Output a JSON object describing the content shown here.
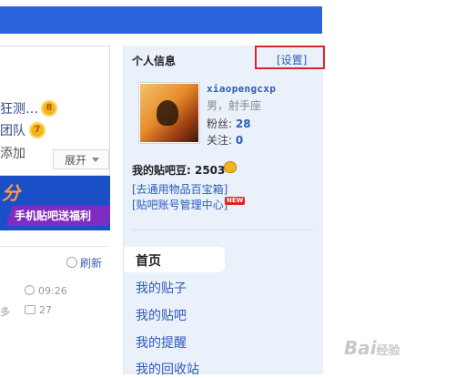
{
  "feed": {
    "items": [
      {
        "text": "狂测…",
        "badge": "8"
      },
      {
        "text": "团队",
        "badge": "7"
      }
    ],
    "add_text": "添加",
    "unfold_label": "展开",
    "promo_char": "分",
    "promo_text": "手机贴吧送福利",
    "refresh_label": "刷新",
    "post_time": "09:26",
    "post_trailing": "多",
    "post_comments": "27"
  },
  "sidebar": {
    "title": "个人信息",
    "settings_label": "[设置]",
    "username": "xiaopengcxp",
    "gender_sign": "男，射手座",
    "fans_label": "粉丝:",
    "fans_count": "28",
    "follow_label": "关注:",
    "follow_count": "0",
    "beans_text": "我的贴吧豆: 2503",
    "links": [
      "[去通用物品百宝箱]",
      "[贴吧账号管理中心]"
    ],
    "new_badge": "NEW",
    "nav": {
      "home": "首页",
      "items": [
        "我的贴子",
        "我的贴吧",
        "我的提醒",
        "我的回收站"
      ]
    }
  },
  "watermark": {
    "main": "Bai",
    "sub": "经验"
  },
  "colors": {
    "brand_blue": "#2a63dc",
    "link_blue": "#2f5bb7",
    "highlight_red": "#d7262d",
    "sidebar_bg": "#eaf1fb"
  }
}
